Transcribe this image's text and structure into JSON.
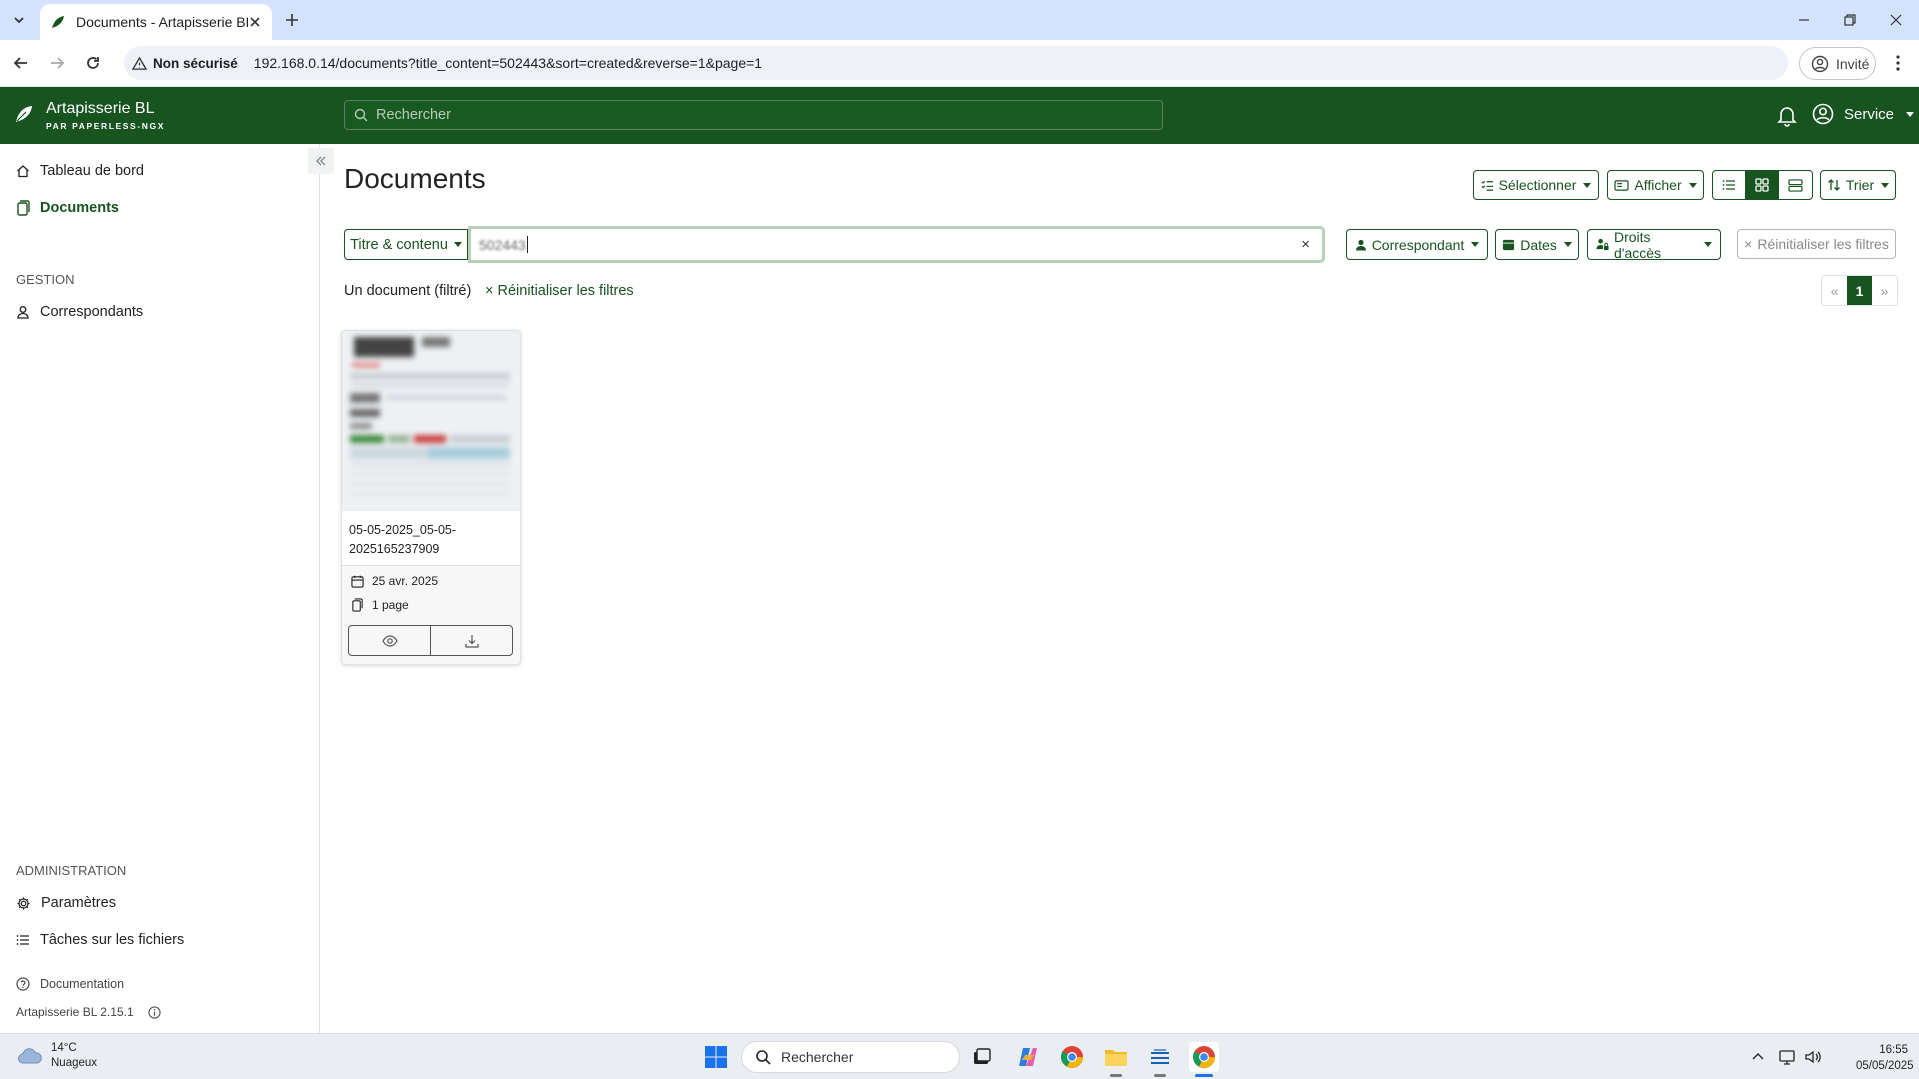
{
  "browser": {
    "tab_title": "Documents - Artapisserie BL",
    "security_label": "Non sécurisé",
    "url": "192.168.0.14/documents?title_content=502443&sort=created&reverse=1&page=1",
    "profile_label": "Invité"
  },
  "app": {
    "brand_name": "Artapisserie BL",
    "brand_sub": "PAR PAPERLESS-NGX",
    "search_placeholder": "Rechercher",
    "user_name": "Service",
    "accent_color": "#17541f"
  },
  "sidebar": {
    "items": [
      {
        "label": "Tableau de bord",
        "icon": "house-icon"
      },
      {
        "label": "Documents",
        "icon": "file-icon",
        "active": true
      }
    ],
    "gestion_heading": "GESTION",
    "gestion_items": [
      {
        "label": "Correspondants",
        "icon": "person-icon"
      }
    ],
    "admin_heading": "ADMINISTRATION",
    "admin_items": [
      {
        "label": "Paramètres",
        "icon": "gear-icon"
      },
      {
        "label": "Tâches sur les fichiers",
        "icon": "list-icon"
      }
    ],
    "documentation_label": "Documentation",
    "version_label": "Artapisserie BL 2.15.1"
  },
  "main": {
    "title": "Documents",
    "toolbar": {
      "select_label": "Sélectionner",
      "show_label": "Afficher",
      "sort_label": "Trier"
    },
    "filter": {
      "field_label": "Titre & contenu",
      "query_value": "502443",
      "correspondent_label": "Correspondant",
      "dates_label": "Dates",
      "permissions_label": "Droits d'accès",
      "reset_label": "Réinitialiser les filtres"
    },
    "result_count": "Un document (filtré)",
    "reset_link": "Réinitialiser les filtres",
    "pager": {
      "prev": "«",
      "current": "1",
      "next": "»"
    },
    "documents": [
      {
        "title": "05-05-2025_05-05-2025165237909",
        "date": "25 avr. 2025",
        "pages": "1 page"
      }
    ]
  },
  "taskbar": {
    "temperature": "14°C",
    "weather": "Nuageux",
    "search_placeholder": "Rechercher",
    "time": "16:55",
    "date": "05/05/2025"
  }
}
